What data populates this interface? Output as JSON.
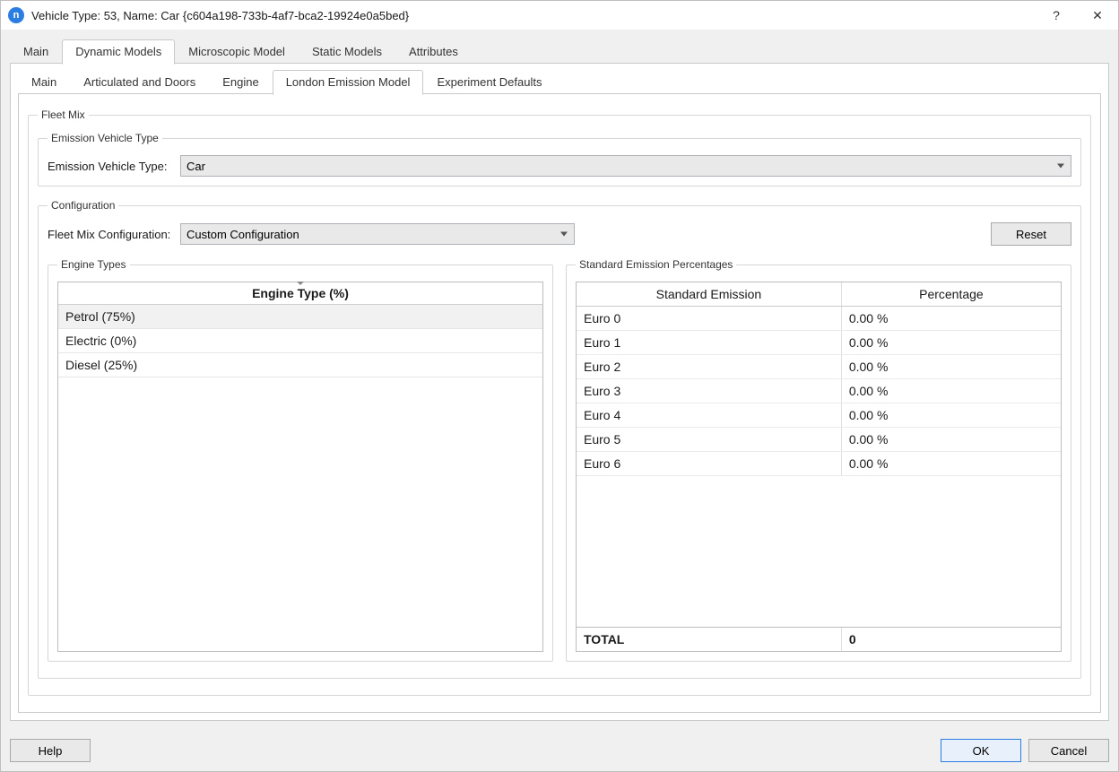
{
  "window": {
    "title": "Vehicle Type: 53, Name: Car  {c604a198-733b-4af7-bca2-19924e0a5bed}",
    "help_symbol": "?",
    "close_symbol": "✕"
  },
  "main_tabs": [
    {
      "label": "Main",
      "active": false
    },
    {
      "label": "Dynamic Models",
      "active": true
    },
    {
      "label": "Microscopic Model",
      "active": false
    },
    {
      "label": "Static Models",
      "active": false
    },
    {
      "label": "Attributes",
      "active": false
    }
  ],
  "sub_tabs": [
    {
      "label": "Main",
      "active": false
    },
    {
      "label": "Articulated and Doors",
      "active": false
    },
    {
      "label": "Engine",
      "active": false
    },
    {
      "label": "London Emission Model",
      "active": true
    },
    {
      "label": "Experiment Defaults",
      "active": false
    }
  ],
  "fleet_mix": {
    "group_label": "Fleet Mix",
    "emission_group_label": "Emission Vehicle Type",
    "emission_label": "Emission Vehicle Type:",
    "emission_value": "Car",
    "config_group_label": "Configuration",
    "config_label": "Fleet Mix Configuration:",
    "config_value": "Custom Configuration",
    "reset_label": "Reset"
  },
  "engine_types": {
    "group_label": "Engine Types",
    "header": "Engine Type (%)",
    "rows": [
      "Petrol (75%)",
      "Electric (0%)",
      "Diesel (25%)"
    ]
  },
  "emission_table": {
    "group_label": "Standard Emission Percentages",
    "col_std": "Standard Emission",
    "col_pct": "Percentage",
    "rows": [
      {
        "std": "Euro 0",
        "pct": "0.00 %"
      },
      {
        "std": "Euro 1",
        "pct": "0.00 %"
      },
      {
        "std": "Euro 2",
        "pct": "0.00 %"
      },
      {
        "std": "Euro 3",
        "pct": "0.00 %"
      },
      {
        "std": "Euro 4",
        "pct": "0.00 %"
      },
      {
        "std": "Euro 5",
        "pct": "0.00 %"
      },
      {
        "std": "Euro 6",
        "pct": "0.00 %"
      }
    ],
    "total_label": "TOTAL",
    "total_value": "0"
  },
  "footer": {
    "help": "Help",
    "ok": "OK",
    "cancel": "Cancel"
  }
}
